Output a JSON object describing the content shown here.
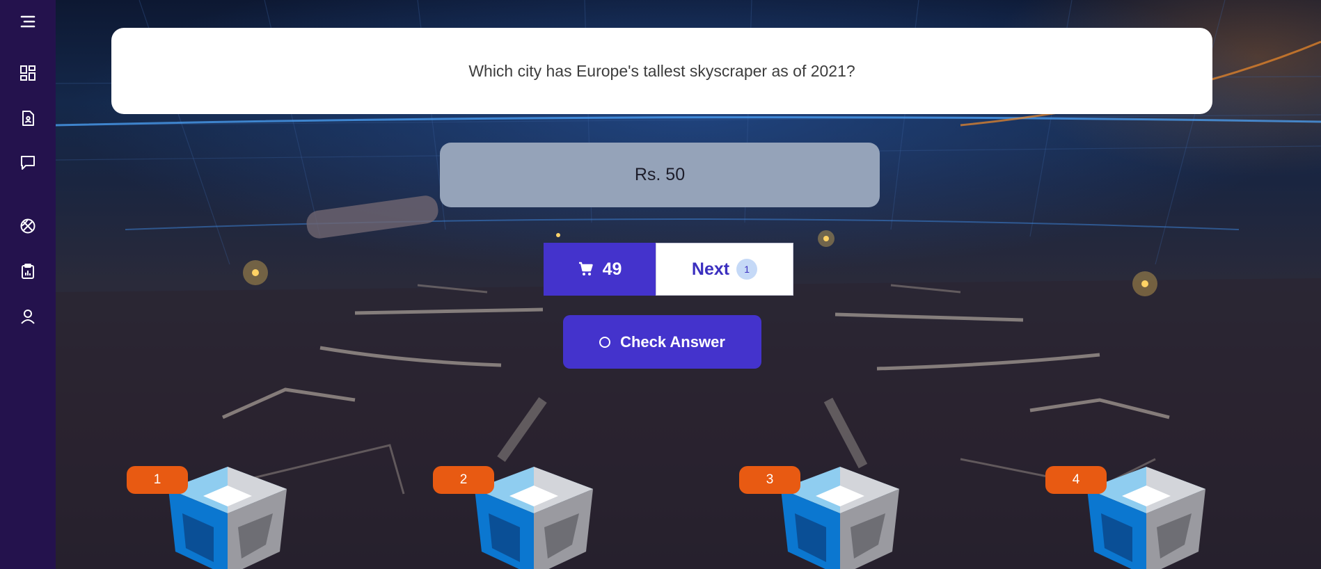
{
  "sidebar": {
    "items": [
      {
        "icon": "menu-icon",
        "label": ""
      },
      {
        "icon": "dashboard-icon",
        "label": ""
      },
      {
        "icon": "document-user-icon",
        "label": ""
      },
      {
        "icon": "chat-icon",
        "label": ""
      },
      {
        "icon": "basketball-icon",
        "label": ""
      },
      {
        "icon": "clipboard-chart-icon",
        "label": ""
      },
      {
        "icon": "user-icon",
        "label": ""
      }
    ]
  },
  "quiz": {
    "question": "Which city has Europe's tallest skyscraper as of 2021?",
    "answer_option": "Rs. 50",
    "cart_count": "49",
    "next_label": "Next",
    "next_badge": "1",
    "check_label": "Check Answer"
  },
  "crates": [
    {
      "number": "1"
    },
    {
      "number": "2"
    },
    {
      "number": "3"
    },
    {
      "number": "4"
    }
  ],
  "colors": {
    "sidebar": "#24124d",
    "primary": "#4433cc",
    "answer_bg": "#95a3b9",
    "badge_orange": "#e85a12"
  }
}
